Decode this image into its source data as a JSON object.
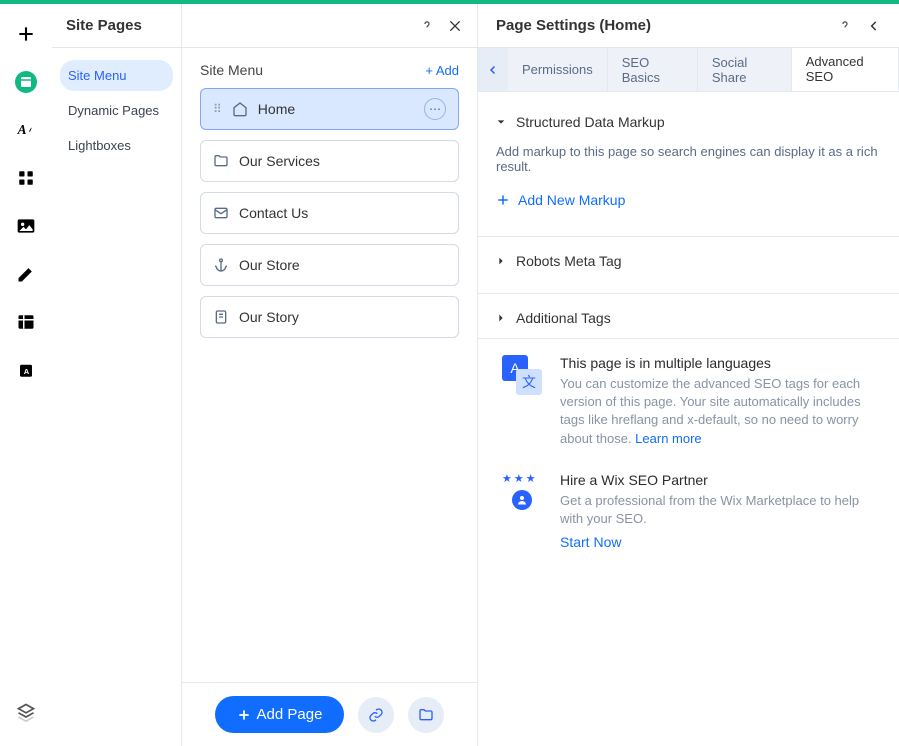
{
  "sitePages": {
    "title": "Site Pages",
    "nav": [
      {
        "label": "Site Menu",
        "active": true
      },
      {
        "label": "Dynamic Pages",
        "active": false
      },
      {
        "label": "Lightboxes",
        "active": false
      }
    ]
  },
  "siteMenu": {
    "title": "Site Menu",
    "add_label": "+ Add",
    "items": [
      {
        "label": "Home",
        "icon": "home",
        "active": true,
        "has_dots": true
      },
      {
        "label": "Our Services",
        "icon": "folder",
        "active": false
      },
      {
        "label": "Contact Us",
        "icon": "mail",
        "active": false
      },
      {
        "label": "Our Store",
        "icon": "anchor",
        "active": false
      },
      {
        "label": "Our Story",
        "icon": "page",
        "active": false
      }
    ],
    "add_page_button": "Add Page"
  },
  "pageSettings": {
    "title": "Page Settings (Home)",
    "tabs": [
      "Permissions",
      "SEO Basics",
      "Social Share",
      "Advanced SEO"
    ],
    "active_tab": 3,
    "accordions": {
      "structured": {
        "title": "Structured Data Markup",
        "desc": "Add markup to this page so search engines can display it as a rich result.",
        "add_markup": "Add New Markup"
      },
      "robots": {
        "title": "Robots Meta Tag"
      },
      "additional": {
        "title": "Additional Tags"
      }
    },
    "multilang": {
      "title": "This page is in multiple languages",
      "desc": "You can customize the advanced SEO tags for each version of this page. Your site automatically includes tags like hreflang and x-default, so no need to worry about those. ",
      "link": "Learn more"
    },
    "partner": {
      "title": "Hire a Wix SEO Partner",
      "desc": "Get a professional from the Wix Marketplace to help with your SEO.",
      "link": "Start Now"
    }
  }
}
